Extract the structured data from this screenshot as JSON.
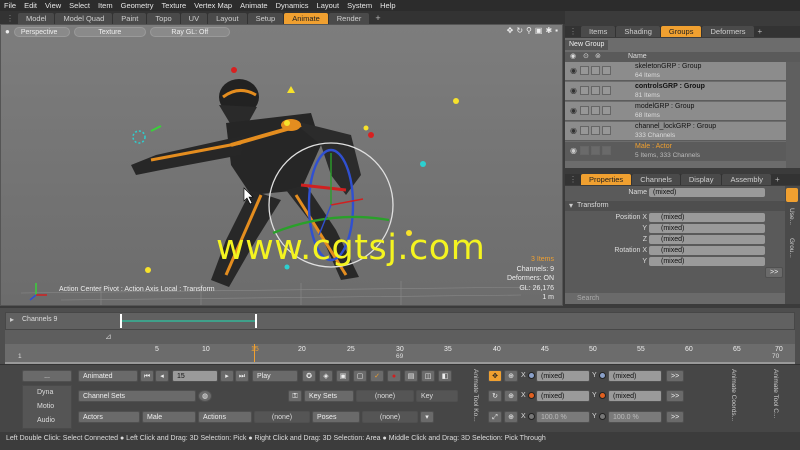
{
  "menu": [
    "File",
    "Edit",
    "View",
    "Select",
    "Item",
    "Geometry",
    "Texture",
    "Vertex Map",
    "Animate",
    "Dynamics",
    "Layout",
    "System",
    "Help"
  ],
  "layout_tabs": [
    "Model",
    "Model Quad",
    "Paint",
    "Topo",
    "UV",
    "Layout",
    "Setup",
    "Animate",
    "Render"
  ],
  "layout_active": "Animate",
  "viewport": {
    "view_mode": "Perspective",
    "shading": "Texture",
    "raygl": "Ray GL: Off",
    "items": "3 Items",
    "channels": "Channels: 9",
    "deformers": "Deformers: ON",
    "gl": "GL: 26,176",
    "scale": "1 m",
    "status": "Action Center Pivot : Action Axis Local : Transform",
    "watermark": "www.cgtsj.com"
  },
  "right_tabs": [
    "Items",
    "Shading",
    "Groups",
    "Deformers"
  ],
  "right_active": "Groups",
  "groups": {
    "new_group": "New Group",
    "name_header": "Name",
    "rows": [
      {
        "name": "skeletonGRP : Group",
        "sub": "64 Items"
      },
      {
        "name": "controlsGRP : Group",
        "sub": "81 Items"
      },
      {
        "name": "modelGRP : Group",
        "sub": "68 Items"
      },
      {
        "name": "channel_lockGRP : Group",
        "sub": "333 Channels"
      },
      {
        "name": "Male : Actor",
        "sub": "5 Items, 333 Channels"
      }
    ]
  },
  "prop_tabs": [
    "Properties",
    "Channels",
    "Display",
    "Assembly"
  ],
  "properties": {
    "name_label": "Name",
    "name_value": "(mixed)",
    "section": "Transform",
    "pos_x_label": "Position X",
    "y_label": "Y",
    "z_label": "Z",
    "rot_x_label": "Rotation X",
    "mixed": "(mixed)",
    "search": "Search",
    "more": ">>"
  },
  "timeline": {
    "label": "Channels 9",
    "ticks": [
      "5",
      "10",
      "15",
      "20",
      "25",
      "30",
      "35",
      "40",
      "45",
      "50",
      "55",
      "60",
      "65",
      "70"
    ],
    "start": "1",
    "mid": "69",
    "end": "70"
  },
  "bottom": {
    "dots": "...",
    "dyna": "Dyna",
    "motion": "Motio",
    "audio": "Audio",
    "animated": "Animated",
    "frame": "15",
    "play": "Play",
    "channel_sets": "Channel Sets",
    "key_sets": "Key Sets",
    "none": "(none)",
    "key": "Key",
    "actors": "Actors",
    "male": "Male",
    "actions": "Actions",
    "poses": "Poses",
    "animate_tool_ko": "Animate Tool Ko...",
    "animate_coords": "Animate Coords...",
    "animate_tool_c": "Animate Tool C...",
    "x": "X",
    "y": "Y",
    "mixed": "(mixed)",
    "pct1": "100.0 %",
    "pct2": "100.0 %",
    "more": ">>"
  },
  "statusbar": "Left Double Click: Select Connected ● Left Click and Drag: 3D Selection: Pick ● Right Click and Drag: 3D Selection: Area ● Middle Click and Drag: 3D Selection: Pick Through",
  "colors": {
    "accent": "#f0a030",
    "viewport": "#777777"
  }
}
